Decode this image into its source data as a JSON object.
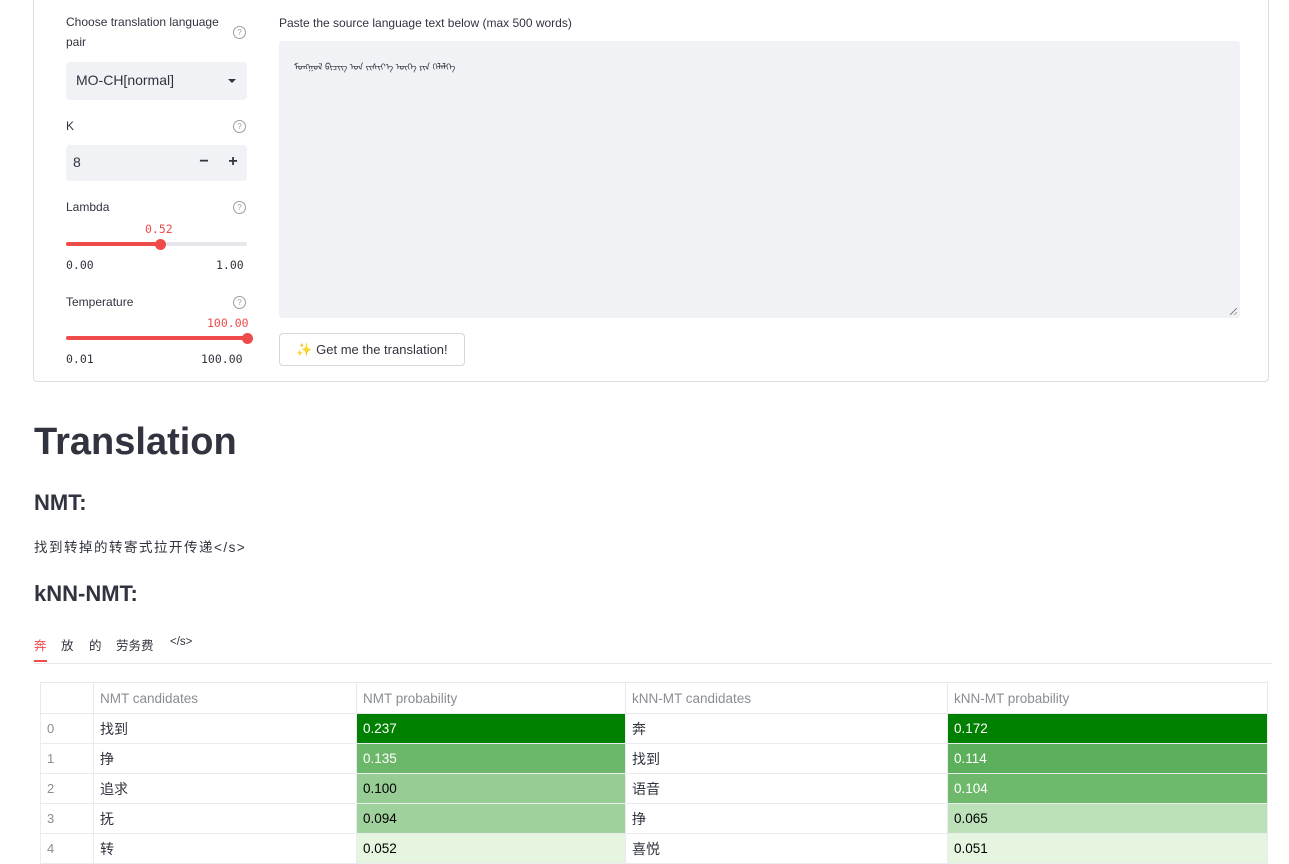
{
  "sidebar": {
    "language_pair": {
      "label": "Choose translation language pair",
      "selected": "MO-CH[normal]"
    },
    "k": {
      "label": "K",
      "value": "8",
      "decrement": "−",
      "increment": "+"
    },
    "lambda": {
      "label": "Lambda",
      "value": "0.52",
      "min": "0.00",
      "max": "1.00",
      "fraction": 0.52
    },
    "temperature": {
      "label": "Temperature",
      "value": "100.00",
      "min": "0.01",
      "max": "100.00",
      "fraction": 1.0
    }
  },
  "source": {
    "label": "Paste the source language text below (max 500 words)",
    "value": "ᠮᠣᠩᠭᠣᠯ ᠪᠢᠴᠢᠭ ᠤᠨ ᠵᠢᠱᠢᠶ᠎ᠡ ᠦᠭᠡ ᠶᠢᠨ ᠬᠡᠯᠡᠯᠭᠡ",
    "button_label": "✨ Get me the translation!"
  },
  "results": {
    "title": "Translation",
    "nmt_heading": "NMT:",
    "nmt_text": "找到转掉的转寄式拉开传递</s>",
    "knn_heading": "kNN-NMT:",
    "tokens": [
      "奔",
      "放",
      "的",
      "劳务费",
      "</s>"
    ],
    "active_token": 0,
    "table": {
      "columns": [
        "",
        "NMT candidates",
        "NMT probability",
        "kNN-MT candidates",
        "kNN-MT probability"
      ],
      "rows": [
        {
          "index": "0",
          "nmt": "找到",
          "nmt_prob": "0.237",
          "knn": "奔",
          "knn_prob": "0.172"
        },
        {
          "index": "1",
          "nmt": "挣",
          "nmt_prob": "0.135",
          "knn": "找到",
          "knn_prob": "0.114"
        },
        {
          "index": "2",
          "nmt": "追求",
          "nmt_prob": "0.100",
          "knn": "语音",
          "knn_prob": "0.104"
        },
        {
          "index": "3",
          "nmt": "抚",
          "nmt_prob": "0.094",
          "knn": "挣",
          "knn_prob": "0.065"
        },
        {
          "index": "4",
          "nmt": "转",
          "nmt_prob": "0.052",
          "knn": "喜悦",
          "knn_prob": "0.051"
        }
      ]
    },
    "colors": {
      "accent": "#ef4b4b",
      "heat_max": "#008000",
      "heat_min": "#e5f5e0"
    }
  }
}
